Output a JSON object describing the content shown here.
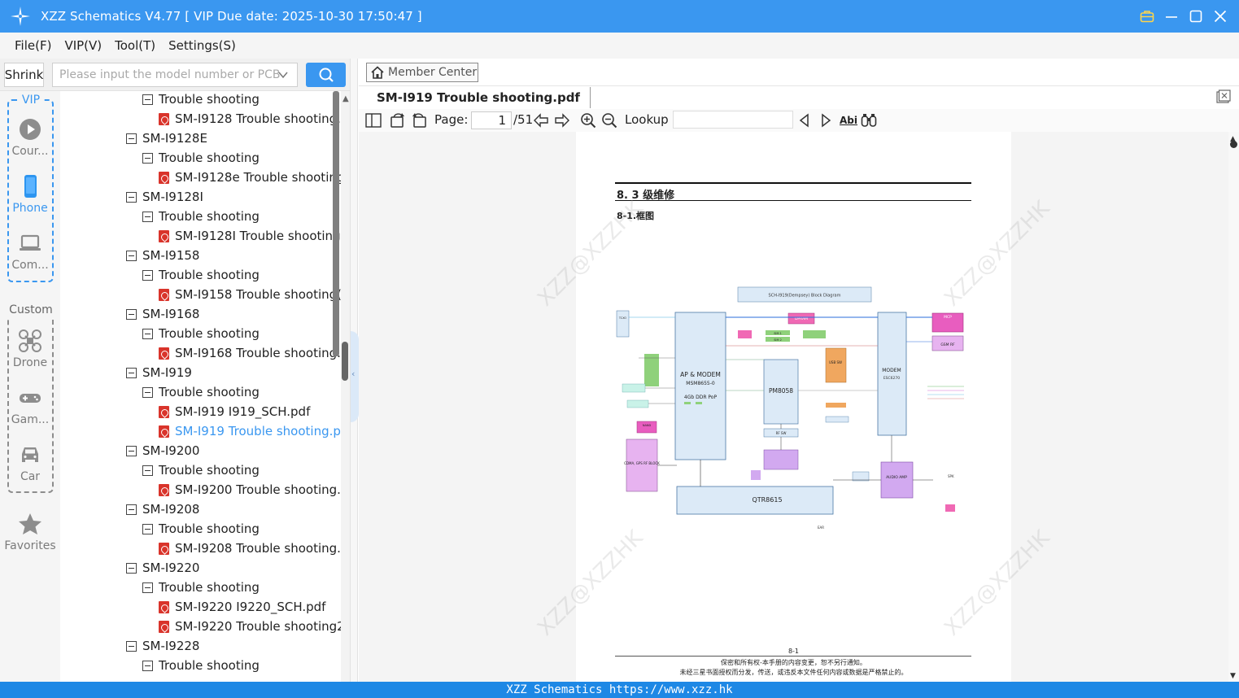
{
  "window": {
    "title": "XZZ Schematics V4.77 [ VIP Due date: 2025-10-30 17:50:47 ]"
  },
  "menu": [
    "File(F)",
    "VIP(V)",
    "Tool(T)",
    "Settings(S)"
  ],
  "search": {
    "shrink_label": "Shrink",
    "placeholder": "Please input the model number or PCB"
  },
  "rail": {
    "vip_label": "VIP",
    "custom_label": "Custom",
    "items": [
      {
        "label": "Cour...",
        "icon": "play-icon"
      },
      {
        "label": "Phone",
        "icon": "phone-icon",
        "active": true
      },
      {
        "label": "Com...",
        "icon": "laptop-icon"
      },
      {
        "label": "Drone",
        "icon": "drone-icon"
      },
      {
        "label": "Gam...",
        "icon": "gamepad-icon"
      },
      {
        "label": "Car",
        "icon": "car-icon"
      },
      {
        "label": "Favorites",
        "icon": "star-icon"
      }
    ]
  },
  "tree": [
    {
      "level": 1,
      "type": "folder",
      "label": "Trouble shooting"
    },
    {
      "level": 2,
      "type": "pdf",
      "label": "SM-I9128 Trouble shooting.p"
    },
    {
      "level": 0,
      "type": "folder",
      "label": "SM-I9128E"
    },
    {
      "level": 1,
      "type": "folder",
      "label": "Trouble shooting"
    },
    {
      "level": 2,
      "type": "pdf",
      "label": "SM-I9128e Trouble shooting"
    },
    {
      "level": 0,
      "type": "folder",
      "label": "SM-I9128I"
    },
    {
      "level": 1,
      "type": "folder",
      "label": "Trouble shooting"
    },
    {
      "level": 2,
      "type": "pdf",
      "label": "SM-I9128I Trouble shooting("
    },
    {
      "level": 0,
      "type": "folder",
      "label": "SM-I9158"
    },
    {
      "level": 1,
      "type": "folder",
      "label": "Trouble shooting"
    },
    {
      "level": 2,
      "type": "pdf",
      "label": "SM-I9158 Trouble shooting("
    },
    {
      "level": 0,
      "type": "folder",
      "label": "SM-I9168"
    },
    {
      "level": 1,
      "type": "folder",
      "label": "Trouble shooting"
    },
    {
      "level": 2,
      "type": "pdf",
      "label": "SM-I9168 Trouble shooting.p"
    },
    {
      "level": 0,
      "type": "folder",
      "label": "SM-I919"
    },
    {
      "level": 1,
      "type": "folder",
      "label": "Trouble shooting"
    },
    {
      "level": 2,
      "type": "pdf",
      "label": "SM-I919 I919_SCH.pdf"
    },
    {
      "level": 2,
      "type": "pdf",
      "label": "SM-I919 Trouble shooting.pc",
      "selected": true
    },
    {
      "level": 0,
      "type": "folder",
      "label": "SM-I9200"
    },
    {
      "level": 1,
      "type": "folder",
      "label": "Trouble shooting"
    },
    {
      "level": 2,
      "type": "pdf",
      "label": "SM-I9200 Trouble shooting.p"
    },
    {
      "level": 0,
      "type": "folder",
      "label": "SM-I9208"
    },
    {
      "level": 1,
      "type": "folder",
      "label": "Trouble shooting"
    },
    {
      "level": 2,
      "type": "pdf",
      "label": "SM-I9208 Trouble shooting.p"
    },
    {
      "level": 0,
      "type": "folder",
      "label": "SM-I9220"
    },
    {
      "level": 1,
      "type": "folder",
      "label": "Trouble shooting"
    },
    {
      "level": 2,
      "type": "pdf",
      "label": "SM-I9220 I9220_SCH.pdf"
    },
    {
      "level": 2,
      "type": "pdf",
      "label": "SM-I9220 Trouble shooting2"
    },
    {
      "level": 0,
      "type": "folder",
      "label": "SM-I9228"
    },
    {
      "level": 1,
      "type": "folder",
      "label": "Trouble shooting"
    }
  ],
  "viewer": {
    "member_center": "Member Center",
    "tab_title": "SM-I919 Trouble shooting.pdf",
    "page_label": "Page:",
    "page_current": "1",
    "page_total": "/51",
    "lookup_label": "Lookup",
    "find_word_label": "Abi"
  },
  "document": {
    "heading": "8. 3 级维修",
    "subheading": "8-1.框图",
    "diagram_title": "SCH-I919(Dempsey) Block Diagram",
    "blocks": {
      "ap": "AP & MODEM",
      "ap_chip": "MSM8655-0",
      "ap_mem": "4Gb DDR PoP",
      "pm": "PM8058",
      "modem": "MODEM",
      "modem_chip": "ESC6270",
      "qtr": "QTR8615",
      "mcp": "MCP",
      "gsm": "GSM RF",
      "cdma": "CDMA, GPS RF BLOCK",
      "dpram": "DPRAM",
      "usb": "USB SW",
      "audio": "AUDIO AMP",
      "nand": "NAND",
      "tcxo": "TCXO",
      "sim1": "SIM 1",
      "sim2": "SIM 2",
      "spk": "SPK",
      "ear": "EAR",
      "rf_sw": "RF SW"
    },
    "page_number": "8-1",
    "footer_line1": "保密和所有权-本手册的内容变更，恕不另行通知。",
    "footer_line2": "未经三星书面授权而分发，传送，或违反本文件任何内容或数据是严格禁止的。",
    "watermark": "XZZ@XZZHK"
  },
  "status": "XZZ Schematics https://www.xzz.hk",
  "colors": {
    "accent": "#3a97f0",
    "status": "#1e88e5",
    "pdf_red": "#d9342b"
  }
}
